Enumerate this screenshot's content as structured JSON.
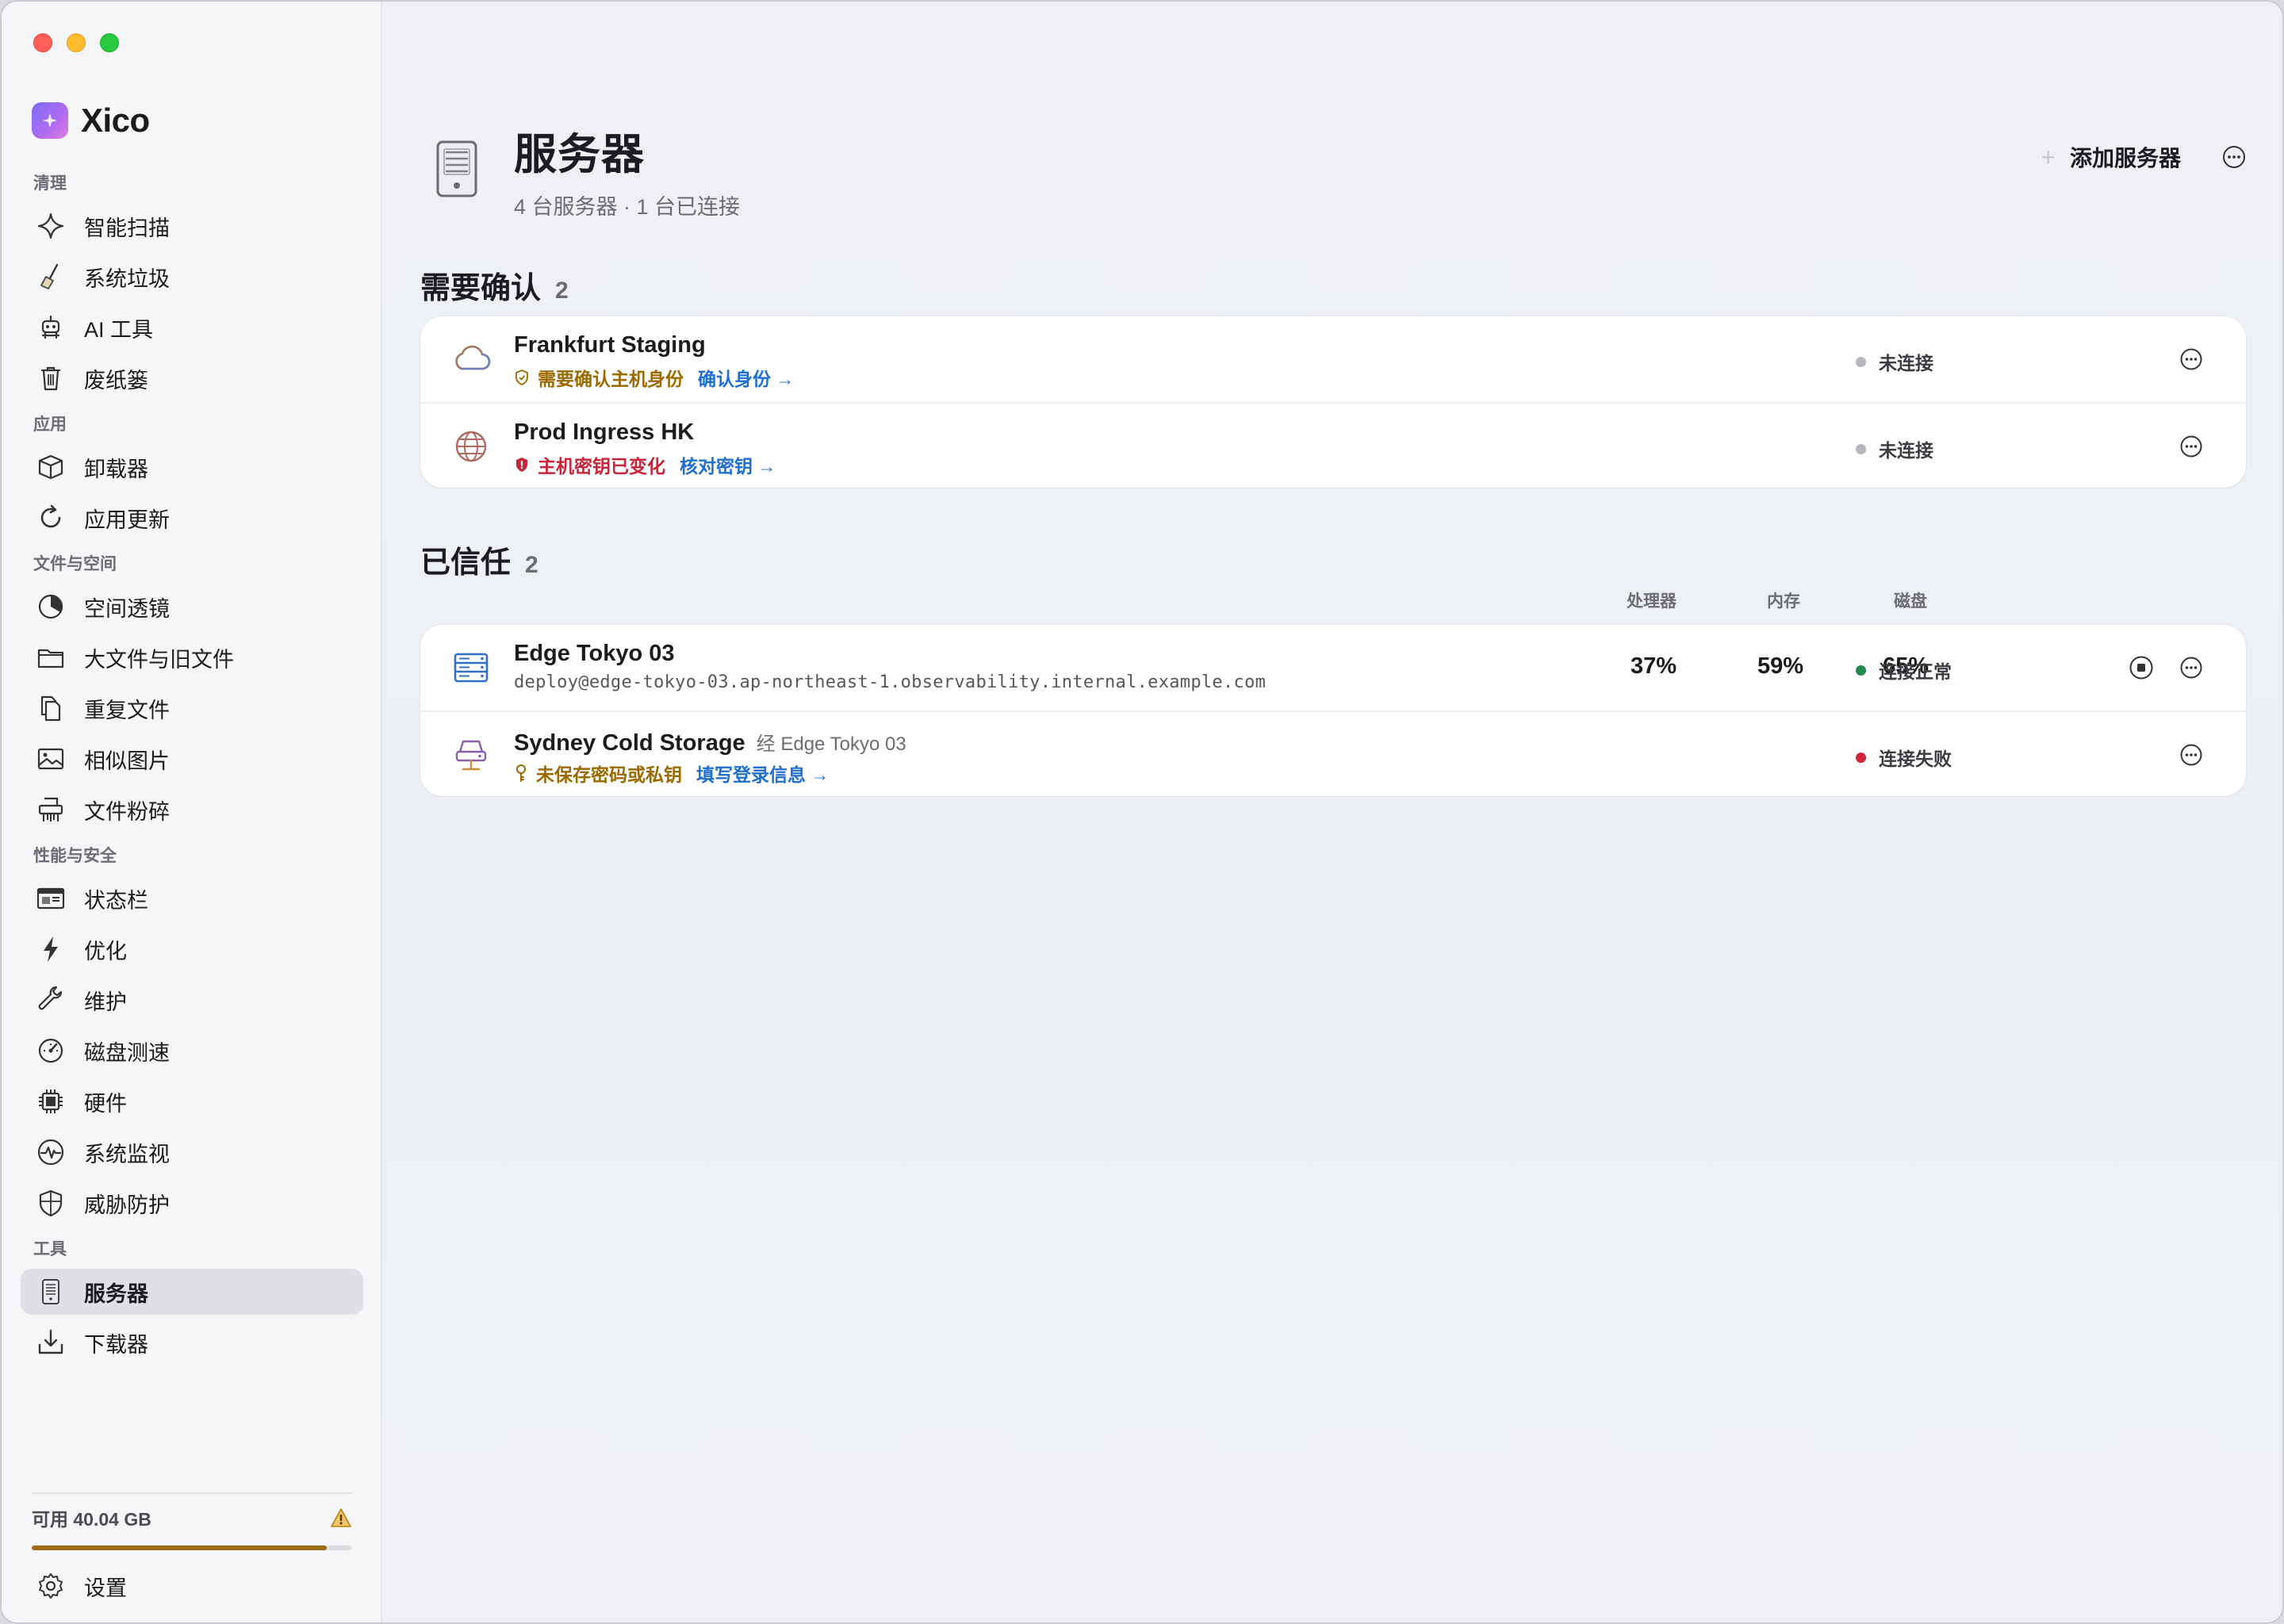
{
  "app": {
    "name": "Xico"
  },
  "sidebar": {
    "sections": [
      {
        "title": "清理",
        "items": [
          {
            "label": "智能扫描",
            "icon": "sparkle-icon"
          },
          {
            "label": "系统垃圾",
            "icon": "broom-icon"
          },
          {
            "label": "AI 工具",
            "icon": "robot-icon"
          },
          {
            "label": "废纸篓",
            "icon": "trash-icon"
          }
        ]
      },
      {
        "title": "应用",
        "items": [
          {
            "label": "卸载器",
            "icon": "package-icon"
          },
          {
            "label": "应用更新",
            "icon": "refresh-icon"
          }
        ]
      },
      {
        "title": "文件与空间",
        "items": [
          {
            "label": "空间透镜",
            "icon": "pie-icon"
          },
          {
            "label": "大文件与旧文件",
            "icon": "folder-icon"
          },
          {
            "label": "重复文件",
            "icon": "duplicate-icon"
          },
          {
            "label": "相似图片",
            "icon": "photo-icon"
          },
          {
            "label": "文件粉碎",
            "icon": "shredder-icon"
          }
        ]
      },
      {
        "title": "性能与安全",
        "items": [
          {
            "label": "状态栏",
            "icon": "menubar-icon"
          },
          {
            "label": "优化",
            "icon": "bolt-icon"
          },
          {
            "label": "维护",
            "icon": "wrench-icon"
          },
          {
            "label": "磁盘测速",
            "icon": "gauge-icon"
          },
          {
            "label": "硬件",
            "icon": "chip-icon"
          },
          {
            "label": "系统监视",
            "icon": "pulse-icon"
          },
          {
            "label": "威胁防护",
            "icon": "shield-icon"
          }
        ]
      },
      {
        "title": "工具",
        "items": [
          {
            "label": "服务器",
            "icon": "server-icon",
            "active": true
          },
          {
            "label": "下载器",
            "icon": "download-icon"
          }
        ]
      }
    ],
    "storage": {
      "label": "可用 40.04 GB",
      "used_fraction": 0.92,
      "warning_icon": "warning-icon"
    },
    "settings": {
      "label": "设置",
      "icon": "gear-icon"
    }
  },
  "page": {
    "title": "服务器",
    "subtitle": "4 台服务器 · 1 台已连接",
    "add_button": "添加服务器"
  },
  "needs_confirm": {
    "title": "需要确认",
    "count": "2",
    "rows": [
      {
        "name": "Frankfurt Staging",
        "warning": "需要确认主机身份",
        "action": "确认身份 →",
        "status": "未连接",
        "status_color": "#b5b7bc"
      },
      {
        "name": "Prod Ingress HK",
        "error": "主机密钥已变化",
        "action": "核对密钥 →",
        "status": "未连接",
        "status_color": "#b5b7bc"
      }
    ]
  },
  "trusted": {
    "title": "已信任",
    "count": "2",
    "columns": {
      "cpu": "处理器",
      "memory": "内存",
      "disk": "磁盘"
    },
    "rows": [
      {
        "name": "Edge Tokyo 03",
        "address": "deploy@edge-tokyo-03.ap-northeast-1.observability.internal.example.com",
        "cpu": "37%",
        "memory": "59%",
        "disk": "65%",
        "status": "连接正常",
        "status_color": "#1f8a4c"
      },
      {
        "name": "Sydney Cold Storage",
        "via": "经 Edge Tokyo 03",
        "warning": "未保存密码或私钥",
        "action": "填写登录信息 →",
        "status": "连接失败",
        "status_color": "#d0253a"
      }
    ]
  },
  "colors": {
    "accent": "#1f6fd1",
    "warning": "#9a6a00",
    "error": "#c8243a"
  }
}
